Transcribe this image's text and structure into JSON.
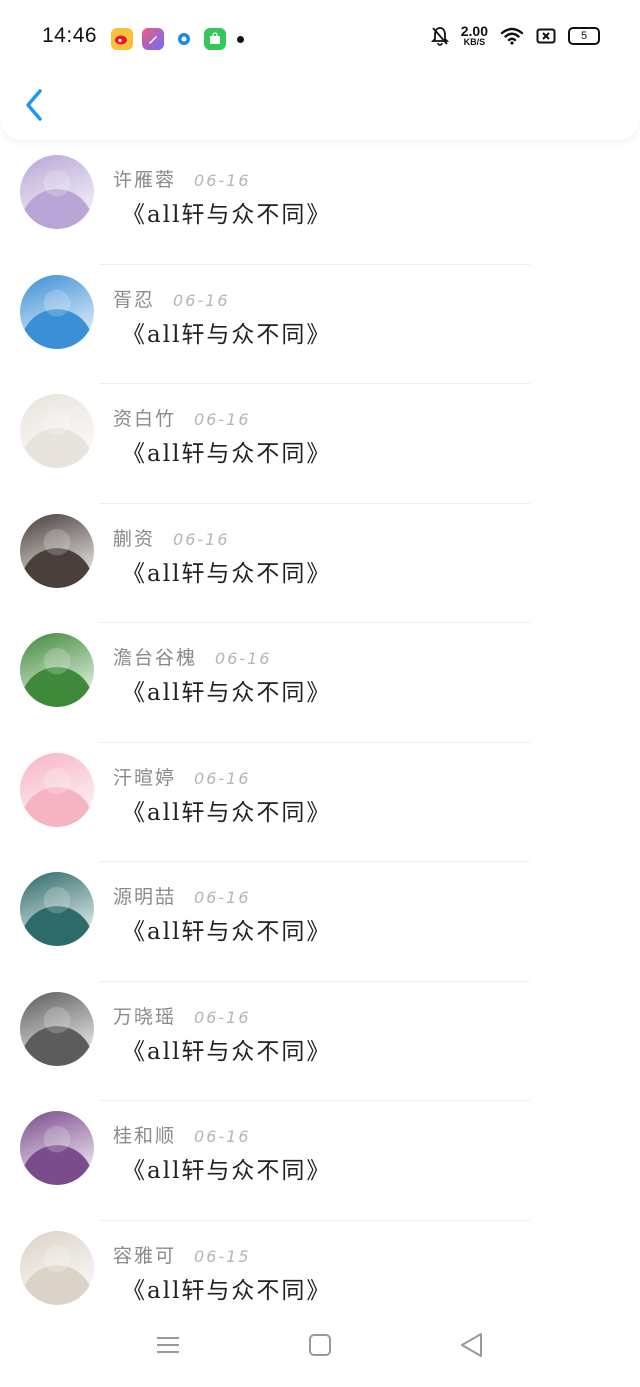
{
  "status_bar": {
    "time": "14:46",
    "net_speed_value": "2.00",
    "net_speed_unit": "KB/S",
    "battery": "5",
    "app_icons": [
      "weibo-icon",
      "pen-app-icon",
      "blue-circle-app-icon",
      "green-store-icon"
    ]
  },
  "header": {
    "back_icon": "chevron-left-icon",
    "accent": "#2196f3"
  },
  "comments": [
    {
      "name": "许雁蓉",
      "date": "06-16",
      "message": "《all轩与众不同》",
      "avatar_color": "#b9a6d6"
    },
    {
      "name": "胥忍",
      "date": "06-16",
      "message": "《all轩与众不同》",
      "avatar_color": "#3b8fd6"
    },
    {
      "name": "资白竹",
      "date": "06-16",
      "message": "《all轩与众不同》",
      "avatar_color": "#e8e3dc"
    },
    {
      "name": "蒯资",
      "date": "06-16",
      "message": "《all轩与众不同》",
      "avatar_color": "#4a3f3b"
    },
    {
      "name": "澹台谷槐",
      "date": "06-16",
      "message": "《all轩与众不同》",
      "avatar_color": "#3f8a3a"
    },
    {
      "name": "汗暄婷",
      "date": "06-16",
      "message": "《all轩与众不同》",
      "avatar_color": "#f6b3c3"
    },
    {
      "name": "源明喆",
      "date": "06-16",
      "message": "《all轩与众不同》",
      "avatar_color": "#2d6a6a"
    },
    {
      "name": "万晓瑶",
      "date": "06-16",
      "message": "《all轩与众不同》",
      "avatar_color": "#5c5c5c"
    },
    {
      "name": "桂和顺",
      "date": "06-16",
      "message": "《all轩与众不同》",
      "avatar_color": "#7b4c8c"
    },
    {
      "name": "容雅可",
      "date": "06-15",
      "message": "《all轩与众不同》",
      "avatar_color": "#dcd3c8"
    }
  ],
  "nav": {
    "menu_icon": "menu-icon",
    "home_icon": "square-home-icon",
    "back_icon": "triangle-back-icon"
  }
}
